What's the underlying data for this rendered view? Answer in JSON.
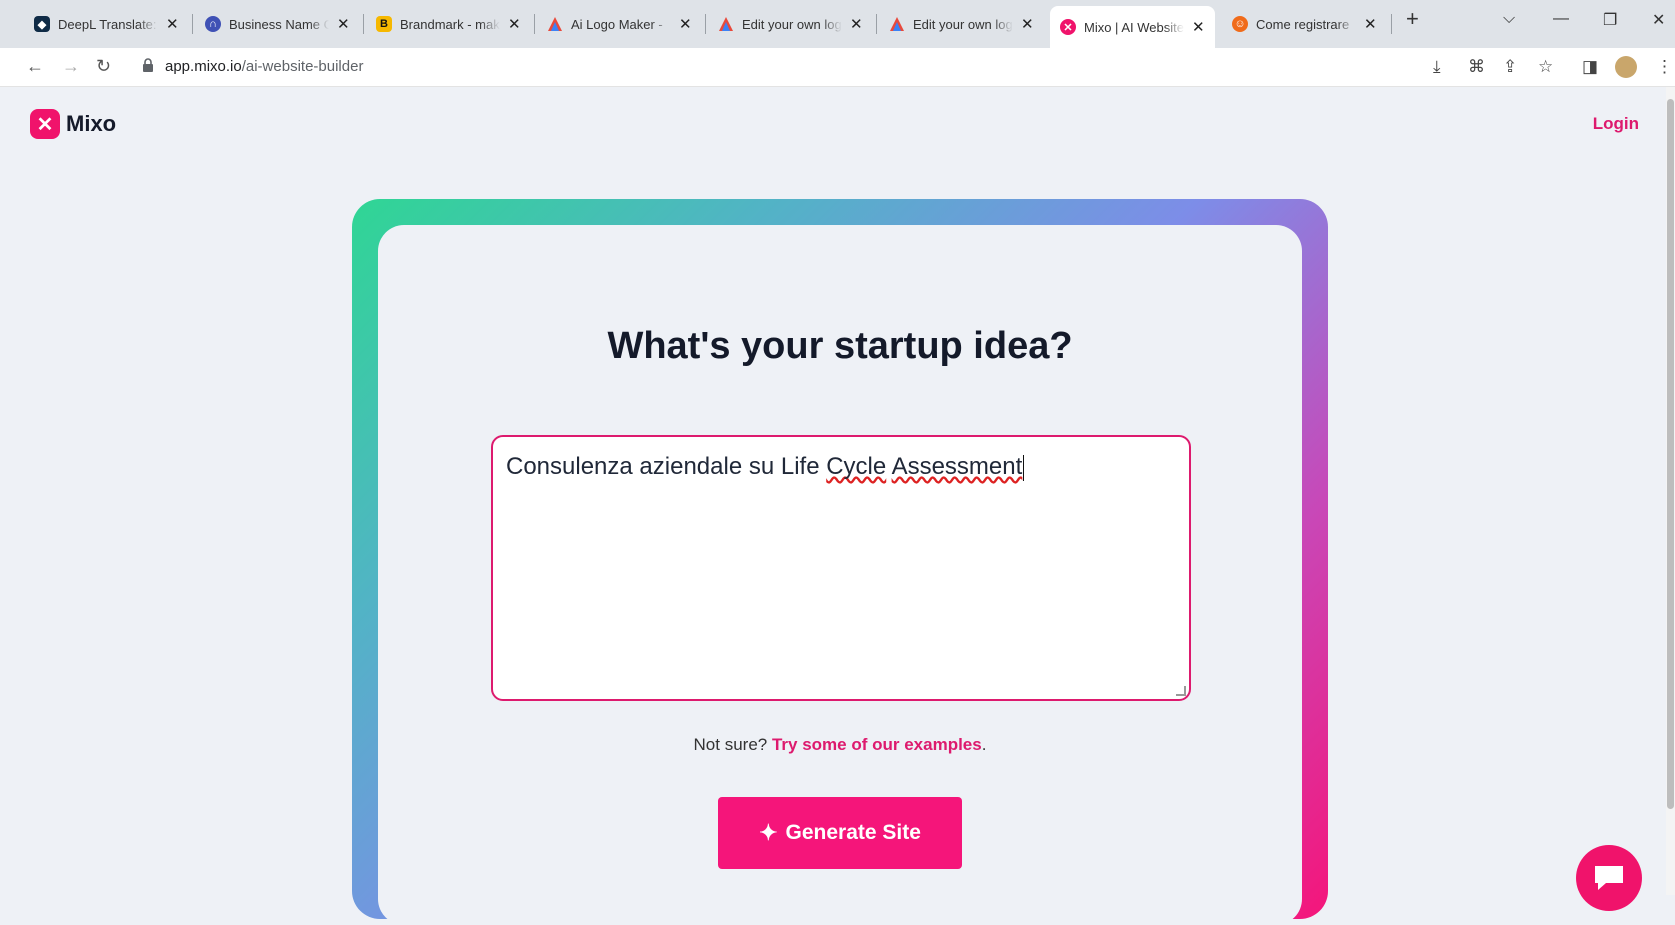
{
  "browser": {
    "tabs": [
      {
        "title": "DeepL Translate: ",
        "icon": "deepl-icon",
        "color": "#0f2b46"
      },
      {
        "title": "Business Name Ge",
        "icon": "namelix-icon",
        "color": "#3f51b5"
      },
      {
        "title": "Brandmark - mak",
        "icon": "brandmark-icon",
        "color": "#f6b800"
      },
      {
        "title": "Ai Logo Maker - ",
        "icon": "triangle-logo-icon",
        "color": "#e84a3c"
      },
      {
        "title": "Edit your own log",
        "icon": "triangle-logo-icon",
        "color": "#e84a3c"
      },
      {
        "title": "Edit your own log",
        "icon": "triangle-logo-icon",
        "color": "#e84a3c"
      },
      {
        "title": "Mixo | AI Website",
        "icon": "mixo-icon",
        "color": "#f0136b"
      },
      {
        "title": "Come registrare ",
        "icon": "smile-icon",
        "color": "#f06b1a"
      }
    ],
    "url_domain": "app.mixo.io",
    "url_path": "/ai-website-builder"
  },
  "header": {
    "logo_text": "Mixo",
    "login_label": "Login"
  },
  "main": {
    "heading": "What's your startup idea?",
    "idea_text_plain": "Consulenza aziendale su Life ",
    "idea_word_1": "Cycle",
    "idea_word_2": "Assessment",
    "not_sure_text": "Not sure? ",
    "examples_link": "Try some of our examples",
    "examples_period": ".",
    "generate_label": "Generate Site"
  },
  "colors": {
    "brand": "#f0136b",
    "accent_text": "#dd1a6e",
    "gradient_start": "#2fd694",
    "gradient_end": "#f5157a"
  }
}
